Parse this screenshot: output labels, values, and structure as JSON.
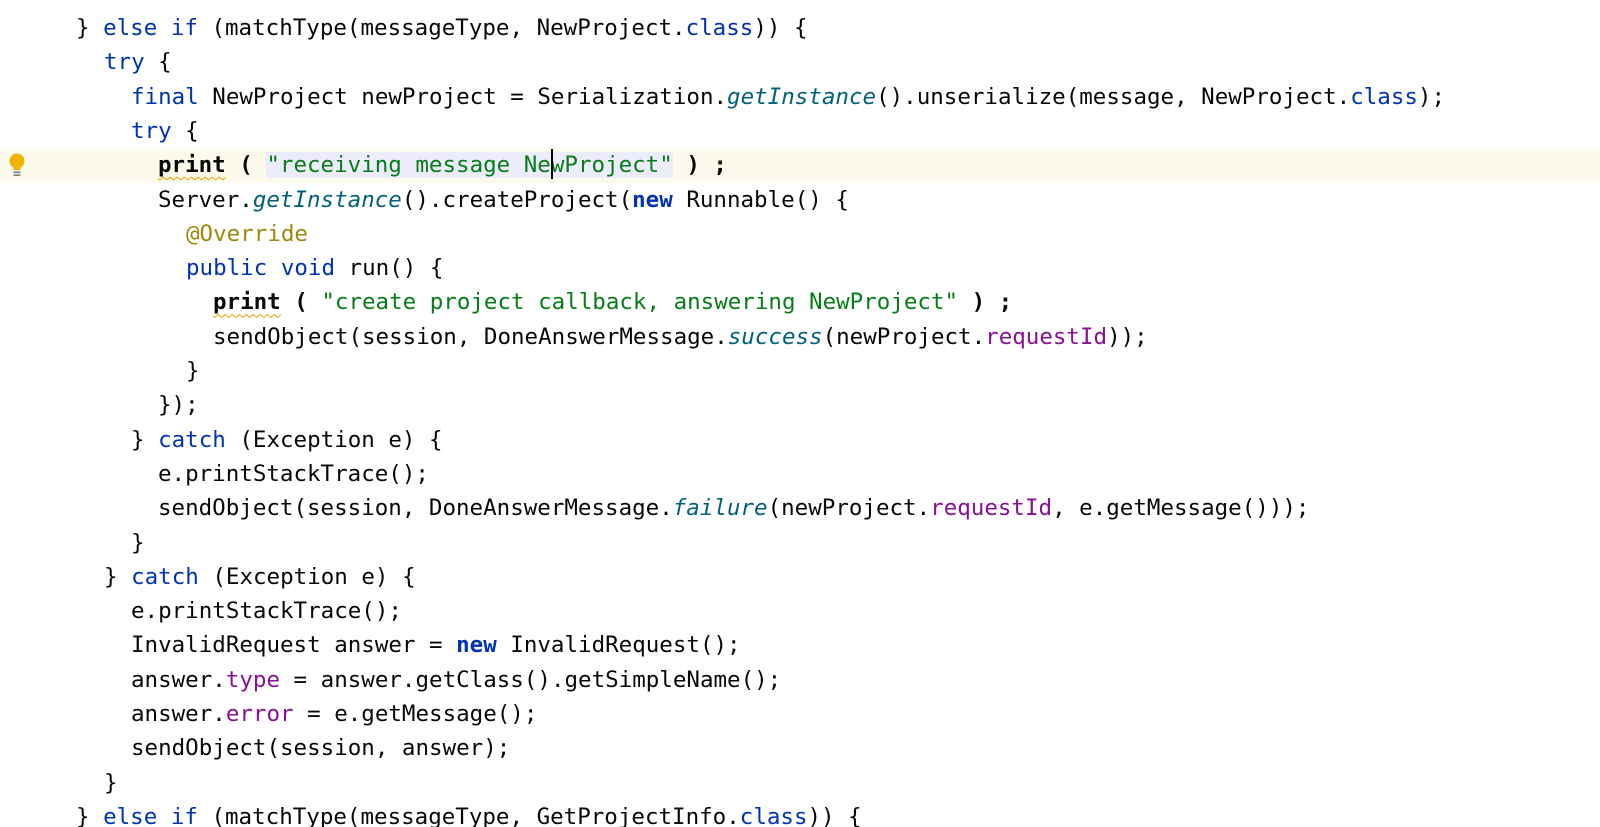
{
  "editor": {
    "current_line_index": 4,
    "caret_offset_after": "receiving message Ne",
    "lines": [
      [
        {
          "t": "} "
        },
        {
          "t": "else if",
          "c": "kw"
        },
        {
          "t": " (matchType(messageType, NewProject."
        },
        {
          "t": "class",
          "c": "kw"
        },
        {
          "t": ")) {"
        }
      ],
      [
        {
          "t": "try",
          "c": "kw"
        },
        {
          "t": " {"
        }
      ],
      [
        {
          "t": "final",
          "c": "kw"
        },
        {
          "t": " NewProject newProject = Serialization."
        },
        {
          "t": "getInstance",
          "c": "ital"
        },
        {
          "t": "().unserialize(message, NewProject."
        },
        {
          "t": "class",
          "c": "kw"
        },
        {
          "t": ");"
        }
      ],
      [
        {
          "t": "try",
          "c": "kw"
        },
        {
          "t": " {"
        }
      ],
      [
        {
          "t": "print",
          "c": "bold warn"
        },
        {
          "t": " ( ",
          "c": "bold"
        },
        {
          "t": "\"receiving message Ne",
          "c": "str sel"
        },
        {
          "t": "",
          "c": "caret"
        },
        {
          "t": "wProject\"",
          "c": "str sel"
        },
        {
          "t": " ) ;",
          "c": "bold"
        }
      ],
      [
        {
          "t": "Server."
        },
        {
          "t": "getInstance",
          "c": "ital"
        },
        {
          "t": "().createProject("
        },
        {
          "t": "new",
          "c": "kwb"
        },
        {
          "t": " Runnable() {"
        }
      ],
      [
        {
          "t": "@Override",
          "c": "ann"
        }
      ],
      [
        {
          "t": "public void",
          "c": "kw"
        },
        {
          "t": " run() {"
        }
      ],
      [
        {
          "t": "print",
          "c": "bold warn"
        },
        {
          "t": " ( ",
          "c": "bold"
        },
        {
          "t": "\"create project callback, answering NewProject\"",
          "c": "str"
        },
        {
          "t": " ) ;",
          "c": "bold"
        }
      ],
      [
        {
          "t": "sendObject(session, DoneAnswerMessage."
        },
        {
          "t": "success",
          "c": "ital"
        },
        {
          "t": "(newProject."
        },
        {
          "t": "requestId",
          "c": "fld"
        },
        {
          "t": "));"
        }
      ],
      [
        {
          "t": "}"
        }
      ],
      [
        {
          "t": "});"
        }
      ],
      [
        {
          "t": "} "
        },
        {
          "t": "catch",
          "c": "kw"
        },
        {
          "t": " (Exception e) {"
        }
      ],
      [
        {
          "t": "e.printStackTrace();"
        }
      ],
      [
        {
          "t": "sendObject(session, DoneAnswerMessage."
        },
        {
          "t": "failure",
          "c": "ital"
        },
        {
          "t": "(newProject."
        },
        {
          "t": "requestId",
          "c": "fld"
        },
        {
          "t": ", e.getMessage()));"
        }
      ],
      [
        {
          "t": "}"
        }
      ],
      [
        {
          "t": "} "
        },
        {
          "t": "catch",
          "c": "kw"
        },
        {
          "t": " (Exception e) {"
        }
      ],
      [
        {
          "t": "e.printStackTrace();"
        }
      ],
      [
        {
          "t": "InvalidRequest answer = "
        },
        {
          "t": "new",
          "c": "kwb"
        },
        {
          "t": " InvalidRequest();"
        }
      ],
      [
        {
          "t": "answer."
        },
        {
          "t": "type",
          "c": "fld"
        },
        {
          "t": " = answer.getClass().getSimpleName();"
        }
      ],
      [
        {
          "t": "answer."
        },
        {
          "t": "error",
          "c": "fld"
        },
        {
          "t": " = e.getMessage();"
        }
      ],
      [
        {
          "t": "sendObject(session, answer);"
        }
      ],
      [
        {
          "t": "}"
        }
      ],
      [
        {
          "t": "} "
        },
        {
          "t": "else if",
          "c": "kw"
        },
        {
          "t": " (matchType(messageType, GetProjectInfo."
        },
        {
          "t": "class",
          "c": "kw"
        },
        {
          "t": ")) {"
        }
      ]
    ]
  },
  "gutter": {
    "icon": "lightbulb-icon",
    "icon_color": "#f0b400"
  }
}
